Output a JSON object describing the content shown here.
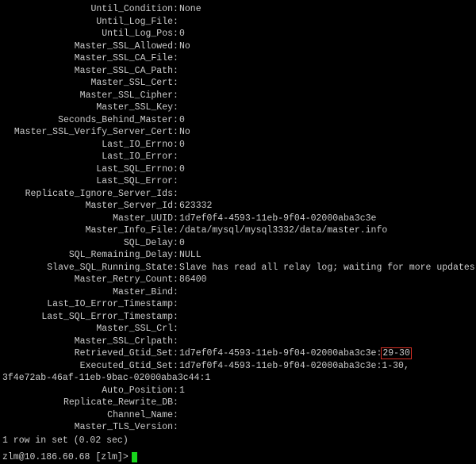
{
  "rows": [
    {
      "label": "Until_Condition",
      "value": "None"
    },
    {
      "label": "Until_Log_File",
      "value": ""
    },
    {
      "label": "Until_Log_Pos",
      "value": "0"
    },
    {
      "label": "Master_SSL_Allowed",
      "value": "No"
    },
    {
      "label": "Master_SSL_CA_File",
      "value": ""
    },
    {
      "label": "Master_SSL_CA_Path",
      "value": ""
    },
    {
      "label": "Master_SSL_Cert",
      "value": ""
    },
    {
      "label": "Master_SSL_Cipher",
      "value": ""
    },
    {
      "label": "Master_SSL_Key",
      "value": ""
    },
    {
      "label": "Seconds_Behind_Master",
      "value": "0"
    },
    {
      "label": "Master_SSL_Verify_Server_Cert",
      "value": "No"
    },
    {
      "label": "Last_IO_Errno",
      "value": "0"
    },
    {
      "label": "Last_IO_Error",
      "value": ""
    },
    {
      "label": "Last_SQL_Errno",
      "value": "0"
    },
    {
      "label": "Last_SQL_Error",
      "value": ""
    },
    {
      "label": "Replicate_Ignore_Server_Ids",
      "value": ""
    },
    {
      "label": "Master_Server_Id",
      "value": "623332"
    },
    {
      "label": "Master_UUID",
      "value": "1d7ef0f4-4593-11eb-9f04-02000aba3c3e"
    },
    {
      "label": "Master_Info_File",
      "value": "/data/mysql/mysql3332/data/master.info"
    },
    {
      "label": "SQL_Delay",
      "value": "0"
    },
    {
      "label": "SQL_Remaining_Delay",
      "value": "NULL"
    },
    {
      "label": "Slave_SQL_Running_State",
      "value": "Slave has read all relay log; waiting for more updates"
    },
    {
      "label": "Master_Retry_Count",
      "value": "86400"
    },
    {
      "label": "Master_Bind",
      "value": ""
    },
    {
      "label": "Last_IO_Error_Timestamp",
      "value": ""
    },
    {
      "label": "Last_SQL_Error_Timestamp",
      "value": ""
    },
    {
      "label": "Master_SSL_Crl",
      "value": ""
    },
    {
      "label": "Master_SSL_Crlpath",
      "value": ""
    }
  ],
  "retrieved": {
    "label": "Retrieved_Gtid_Set",
    "prefix": "1d7ef0f4-4593-11eb-9f04-02000aba3c3e:",
    "highlight": "29-30"
  },
  "executed": {
    "label": "Executed_Gtid_Set",
    "value": "1d7ef0f4-4593-11eb-9f04-02000aba3c3e:1-30,",
    "wrap": "3f4e72ab-46af-11eb-9bac-02000aba3c44:1"
  },
  "tail": [
    {
      "label": "Auto_Position",
      "value": "1"
    },
    {
      "label": "Replicate_Rewrite_DB",
      "value": ""
    },
    {
      "label": "Channel_Name",
      "value": ""
    },
    {
      "label": "Master_TLS_Version",
      "value": ""
    }
  ],
  "footer": "1 row in set (0.02 sec)",
  "prompt": "zlm@10.186.60.68 [zlm]>"
}
